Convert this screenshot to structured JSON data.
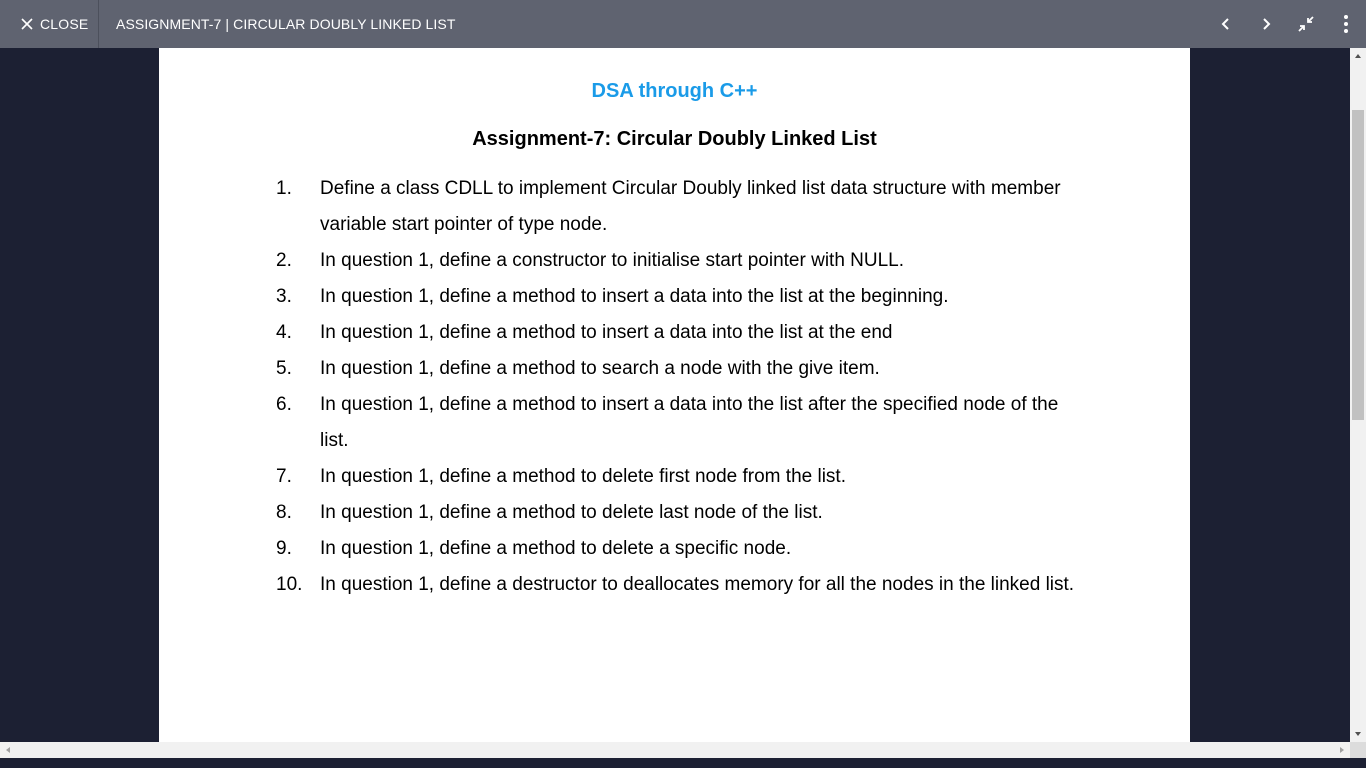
{
  "header": {
    "close_label": "CLOSE",
    "title": "ASSIGNMENT-7 | CIRCULAR DOUBLY LINKED LIST",
    "icons": [
      "previous-icon",
      "next-icon",
      "exit-fullscreen-icon",
      "more-options-icon"
    ]
  },
  "document": {
    "subject": "DSA through C++",
    "title": "Assignment-7: Circular Doubly Linked List",
    "questions": [
      {
        "num": "1.",
        "text": "Define a class CDLL to implement Circular Doubly linked list data structure with member variable start pointer of type node."
      },
      {
        "num": "2.",
        "text": "In question 1, define a constructor to initialise start pointer with NULL."
      },
      {
        "num": "3.",
        "text": "In question 1, define a method to insert a data into the list at the beginning."
      },
      {
        "num": "4.",
        "text": "In question 1, define a method to insert a data into the list at the end"
      },
      {
        "num": "5.",
        "text": "In question 1, define a method to search a node with the give item."
      },
      {
        "num": "6.",
        "text": "In question 1, define a method to insert a data into the list after the specified node of the list."
      },
      {
        "num": "7.",
        "text": "In question 1, define a method to delete first node from the list."
      },
      {
        "num": "8.",
        "text": "In question 1, define a method to delete last node of the list."
      },
      {
        "num": "9.",
        "text": "In question 1, define a method to delete a specific node."
      },
      {
        "num": "10.",
        "text": "In question 1, define a destructor to deallocates memory for all the nodes in the linked list."
      }
    ]
  },
  "colors": {
    "topbar": "#5f6370",
    "background": "#1c2033",
    "subject": "#1a9be8"
  }
}
